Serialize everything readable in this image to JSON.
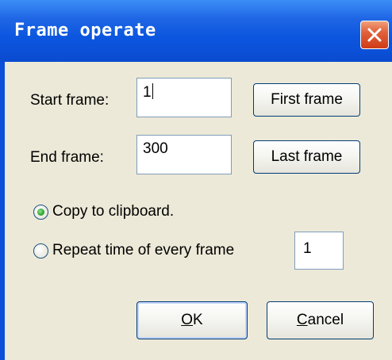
{
  "dialog": {
    "title": "Frame operate"
  },
  "start_frame": {
    "label": "Start frame:",
    "value": "1",
    "button_label": "First frame"
  },
  "end_frame": {
    "label": "End frame:",
    "value": "300",
    "button_label": "Last frame"
  },
  "options": {
    "copy_label": "Copy to clipboard.",
    "copy_selected": true,
    "repeat_label": "Repeat time of every frame",
    "repeat_selected": false,
    "repeat_value": "1"
  },
  "footer": {
    "ok_mnemonic": "O",
    "ok_rest": "K",
    "cancel_mnemonic": "C",
    "cancel_rest": "ancel"
  },
  "colors": {
    "titlebar": "#0c56df",
    "window_bg": "#ece9d8",
    "close_button": "#cf3c16",
    "radio_selected": "#2fa42f"
  }
}
